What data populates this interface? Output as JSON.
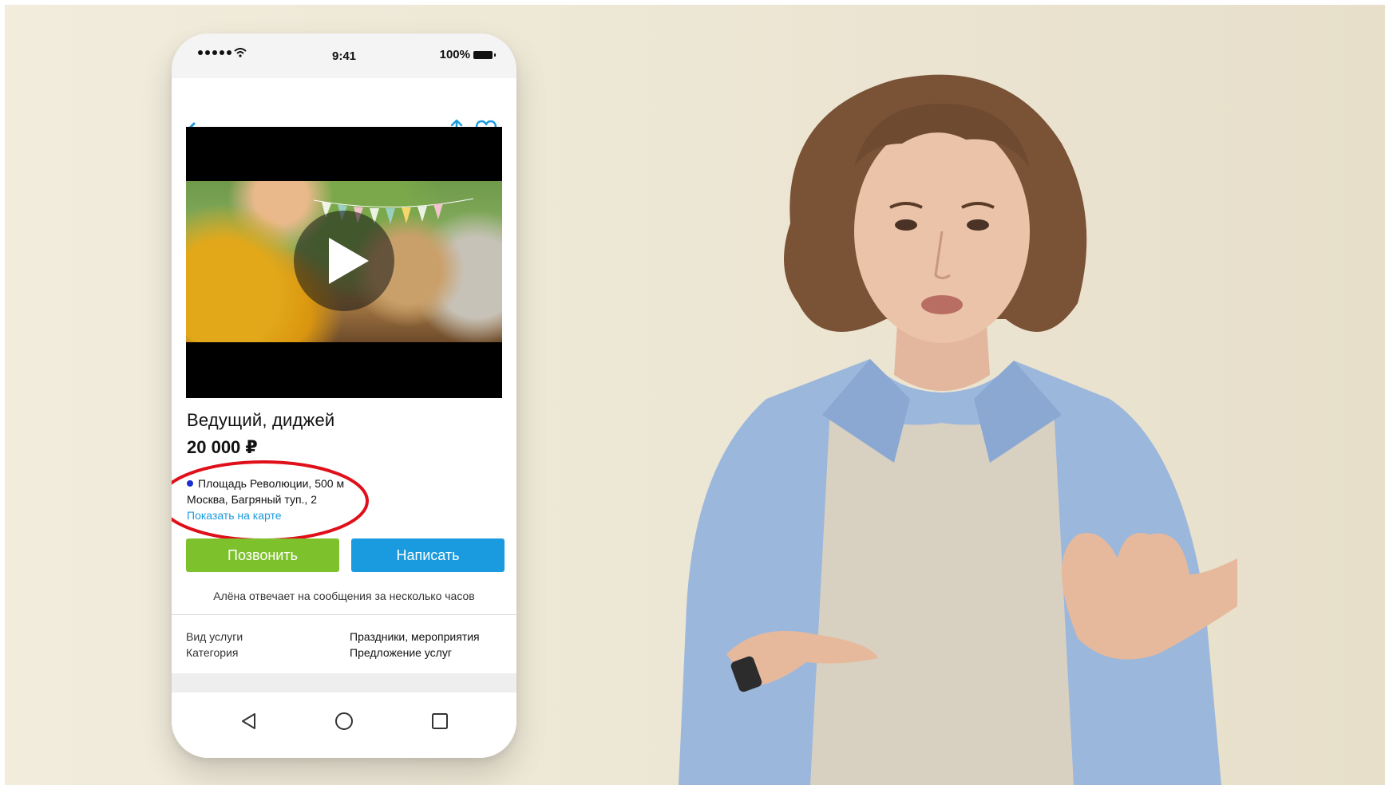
{
  "status_bar": {
    "time": "9:41",
    "battery": "100%",
    "signal_icon": "cellular-signal-icon",
    "wifi_icon": "wifi-icon",
    "battery_icon": "battery-full-icon"
  },
  "app_bar": {
    "back_icon": "arrow-left-icon",
    "share_icon": "share-icon",
    "favorite_icon": "heart-icon",
    "accent": "#1a9be0"
  },
  "listing": {
    "title": "Ведущий, диджей",
    "price": "20 000 ₽",
    "metro": "Площадь Революции, 500 м",
    "address": "Москва, Багряный туп., 2",
    "map_link": "Показать на карте",
    "call_button": "Позвонить",
    "write_button": "Написать",
    "reply_note": "Алёна отвечает на сообщения за несколько часов",
    "params": [
      {
        "label": "Вид услуги",
        "value": "Праздники, мероприятия"
      },
      {
        "label": "Категория",
        "value": "Предложение услуг"
      }
    ],
    "colors": {
      "call": "#7dc22c",
      "write": "#1a9be0",
      "metro_line": "#1a2fd0",
      "highlight": "#e0101a"
    }
  },
  "android_nav": {
    "back_icon": "nav-back-triangle-icon",
    "home_icon": "nav-home-circle-icon",
    "recent_icon": "nav-recent-square-icon"
  }
}
